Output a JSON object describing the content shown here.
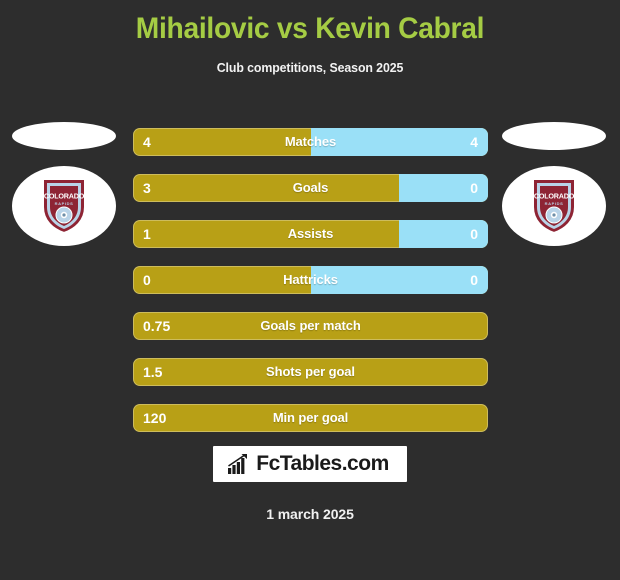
{
  "header": {
    "title": "Mihailovic vs Kevin Cabral",
    "subtitle": "Club competitions, Season 2025",
    "title_color": "#a5cc44",
    "subtitle_color": "#f2f2f2"
  },
  "colors": {
    "background": "#2d2d2d",
    "bar_left": "#b8a016",
    "bar_right": "#9ae0f7",
    "crest_primary": "#8e2434",
    "crest_secondary": "#b9d3e8"
  },
  "players": {
    "left": {
      "photo_placeholder": "player-photo-placeholder",
      "club_name": "Colorado Rapids",
      "crest_line1": "COLORADO",
      "crest_line2": "RAPIDS"
    },
    "right": {
      "photo_placeholder": "player-photo-placeholder",
      "club_name": "Colorado Rapids",
      "crest_line1": "COLORADO",
      "crest_line2": "RAPIDS"
    }
  },
  "chart_data": {
    "type": "bar",
    "title": "Mihailovic vs Kevin Cabral",
    "subtitle": "Club competitions, Season 2025",
    "orientation": "horizontal-diverging",
    "legend": [
      "Mihailovic",
      "Kevin Cabral"
    ],
    "categories": [
      "Matches",
      "Goals",
      "Assists",
      "Hattricks",
      "Goals per match",
      "Shots per goal",
      "Min per goal"
    ],
    "series": [
      {
        "name": "Mihailovic",
        "color": "#b8a016",
        "values": [
          4,
          3,
          1,
          0,
          0.75,
          1.5,
          120
        ]
      },
      {
        "name": "Kevin Cabral",
        "color": "#9ae0f7",
        "values": [
          4,
          0,
          0,
          0,
          null,
          null,
          null
        ]
      }
    ]
  },
  "rows": [
    {
      "label": "Matches",
      "left_value": "4",
      "right_value": "4",
      "left_pct": 50,
      "split": true
    },
    {
      "label": "Goals",
      "left_value": "3",
      "right_value": "0",
      "left_pct": 75,
      "split": true
    },
    {
      "label": "Assists",
      "left_value": "1",
      "right_value": "0",
      "left_pct": 75,
      "split": true
    },
    {
      "label": "Hattricks",
      "left_value": "0",
      "right_value": "0",
      "left_pct": 50,
      "split": true
    },
    {
      "label": "Goals per match",
      "left_value": "0.75",
      "right_value": "",
      "left_pct": 100,
      "split": false
    },
    {
      "label": "Shots per goal",
      "left_value": "1.5",
      "right_value": "",
      "left_pct": 100,
      "split": false
    },
    {
      "label": "Min per goal",
      "left_value": "120",
      "right_value": "",
      "left_pct": 100,
      "split": false
    }
  ],
  "footer": {
    "brand": "FcTables.com",
    "brand_icon": "bar-chart-icon",
    "date": "1 march 2025"
  }
}
